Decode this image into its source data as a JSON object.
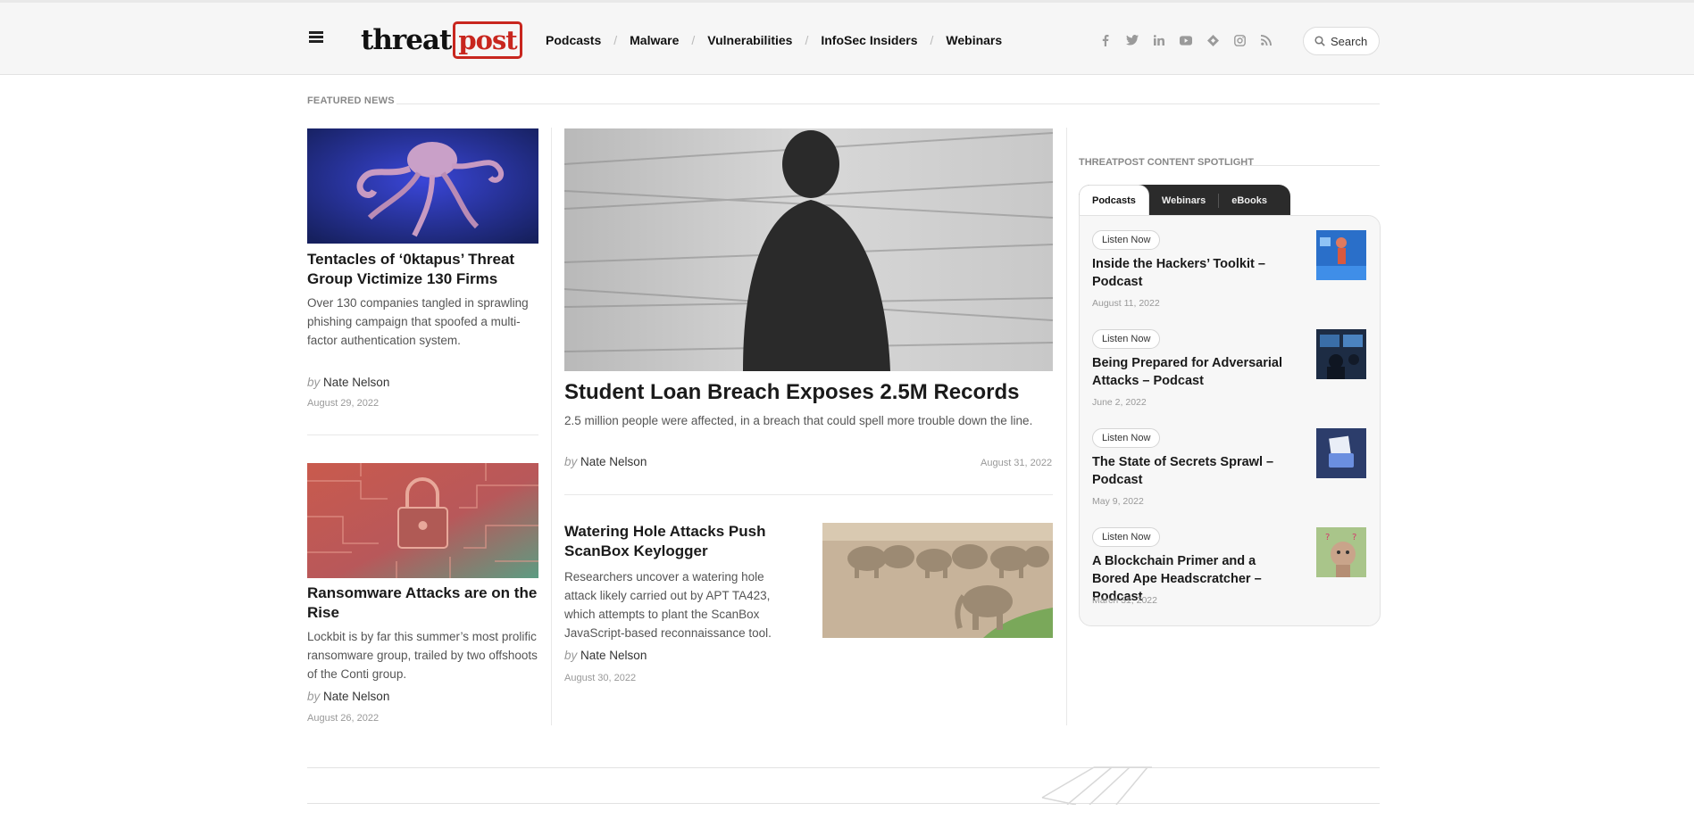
{
  "header": {
    "logo_part1": "threat",
    "logo_part2": "post",
    "nav": [
      "Podcasts",
      "Malware",
      "Vulnerabilities",
      "InfoSec Insiders",
      "Webinars"
    ],
    "nav_separator": "/",
    "social_icons": [
      "facebook-icon",
      "twitter-icon",
      "linkedin-icon",
      "youtube-icon",
      "feedly-icon",
      "instagram-icon",
      "rss-icon"
    ],
    "search_label": "Search"
  },
  "featured": {
    "label": "FEATURED NEWS",
    "articles": [
      {
        "title": "Tentacles of ‘0ktapus’ Threat Group Victimize 130 Firms",
        "excerpt": "Over 130 companies tangled in sprawling phishing campaign that spoofed a multi-factor authentication system.",
        "by": "by",
        "author": "Nate Nelson",
        "date": "August 29, 2022"
      },
      {
        "title": "Ransomware Attacks are on the Rise",
        "excerpt": "Lockbit is by far this summer’s most prolific ransomware group, trailed by two offshoots of the Conti group.",
        "by": "by",
        "author": "Nate Nelson",
        "date": "August 26, 2022"
      },
      {
        "title": "Student Loan Breach Exposes 2.5M Records",
        "excerpt": "2.5 million people were affected, in a breach that could spell more trouble down the line.",
        "by": "by",
        "author": "Nate Nelson",
        "date": "August 31, 2022"
      },
      {
        "title": "Watering Hole Attacks Push ScanBox Keylogger",
        "excerpt": "Researchers uncover a watering hole attack likely carried out by APT TA423, which attempts to plant the ScanBox JavaScript-based reconnaissance tool.",
        "by": "by",
        "author": "Nate Nelson",
        "date": "August 30, 2022"
      }
    ]
  },
  "spotlight": {
    "label": "THREATPOST CONTENT SPOTLIGHT",
    "tabs": [
      "Podcasts",
      "Webinars",
      "eBooks"
    ],
    "items": [
      {
        "cta": "Listen Now",
        "title": "Inside the Hackers’ Toolkit – Podcast",
        "date": "August 11, 2022"
      },
      {
        "cta": "Listen Now",
        "title": "Being Prepared for Adversarial Attacks – Podcast",
        "date": "June 2, 2022"
      },
      {
        "cta": "Listen Now",
        "title": "The State of Secrets Sprawl – Podcast",
        "date": "May 9, 2022"
      },
      {
        "cta": "Listen Now",
        "title": "A Blockchain Primer and a Bored Ape Headscratcher – Podcast",
        "date": "March 31, 2022"
      }
    ]
  }
}
